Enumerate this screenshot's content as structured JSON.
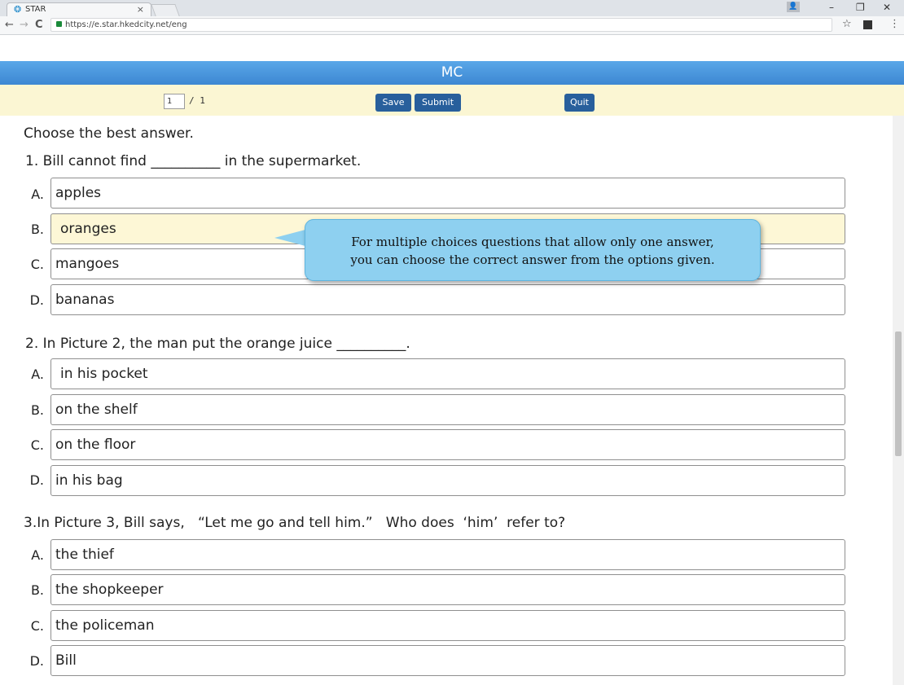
{
  "browser": {
    "tab_title": "STAR",
    "tab_close": "×",
    "url": "https://e.star.hkedcity.net/eng",
    "window_controls": {
      "minimize": "–",
      "restore": "❐",
      "close": "✕"
    },
    "nav": {
      "back": "←",
      "forward": "→",
      "reload": "C"
    },
    "icons": {
      "favicon": "star-logo-icon",
      "lock": "lock-icon",
      "bookmark": "star-icon",
      "menu": "kebab-menu-icon"
    }
  },
  "app": {
    "title": "MC",
    "page": {
      "current": "1",
      "total": "/ 1"
    },
    "buttons": {
      "save": "Save",
      "submit": "Submit",
      "quit": "Quit"
    },
    "colors": {
      "header": "#4a97de",
      "toolbar": "#fbf6d3",
      "button": "#285f9c",
      "tooltip": "#8ed0f0",
      "selected": "#fdf7d6"
    }
  },
  "instruction": "Choose the best answer.",
  "questions": [
    {
      "text": "1.  Bill cannot find __________ in the supermarket.",
      "options": [
        {
          "letter": "A.",
          "text": "apples"
        },
        {
          "letter": "B.",
          "text": "oranges"
        },
        {
          "letter": "C.",
          "text": "mangoes"
        },
        {
          "letter": "D.",
          "text": "bananas"
        }
      ],
      "selected": "B."
    },
    {
      "text": "2.  In Picture 2, the man put the orange juice __________.",
      "options": [
        {
          "letter": "A.",
          "text": "in his pocket"
        },
        {
          "letter": "B.",
          "text": "on the shelf"
        },
        {
          "letter": "C.",
          "text": "on the floor"
        },
        {
          "letter": "D.",
          "text": "in his bag"
        }
      ]
    },
    {
      "text": "3.In Picture 3, Bill says,   “Let me go and tell him.”   Who does  ‘him’  refer to?",
      "options": [
        {
          "letter": "A.",
          "text": "the thief"
        },
        {
          "letter": "B.",
          "text": "the shopkeeper"
        },
        {
          "letter": "C.",
          "text": "the policeman"
        },
        {
          "letter": "D.",
          "text": "Bill"
        }
      ]
    }
  ],
  "tooltip": {
    "line1": "For multiple choices questions that allow only one answer,",
    "line2": "you can choose the correct answer from the options given."
  }
}
